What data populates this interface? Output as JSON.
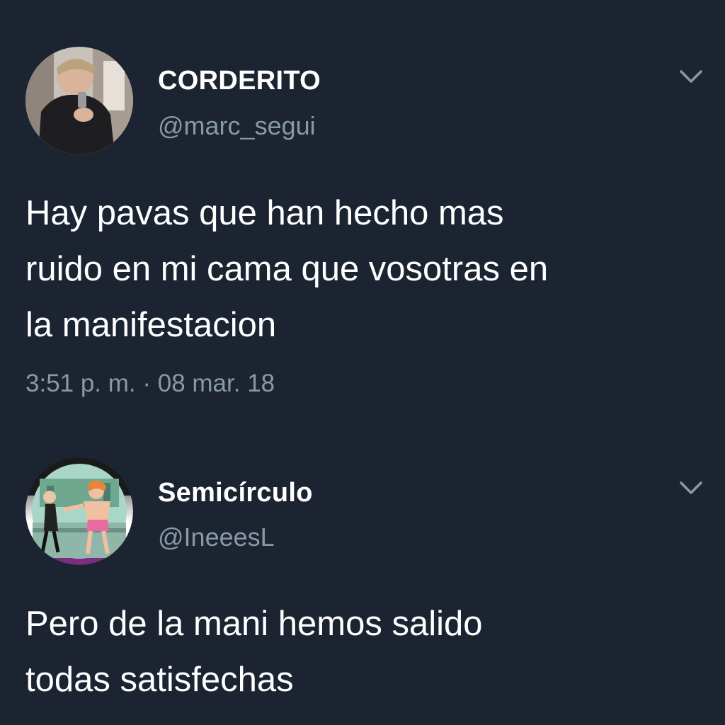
{
  "tweets": [
    {
      "display_name": "CORDERITO",
      "handle": "@marc_segui",
      "text": "Hay pavas que han hecho mas\nruido en mi cama que vosotras en\nla manifestacion",
      "timestamp": "3:51 p. m. · 08 mar. 18",
      "avatar_icon": "profile-photo-selfie",
      "menu_icon": "chevron-down-icon"
    },
    {
      "display_name": "Semicírculo",
      "handle": "@IneeesL",
      "text": "Pero de la mani hemos salido\ntodas satisfechas",
      "avatar_icon": "profile-photo-cartoon",
      "menu_icon": "chevron-down-icon"
    }
  ],
  "colors": {
    "background": "#1c2432",
    "primary_text": "#ffffff",
    "secondary_text": "#8899a6"
  }
}
